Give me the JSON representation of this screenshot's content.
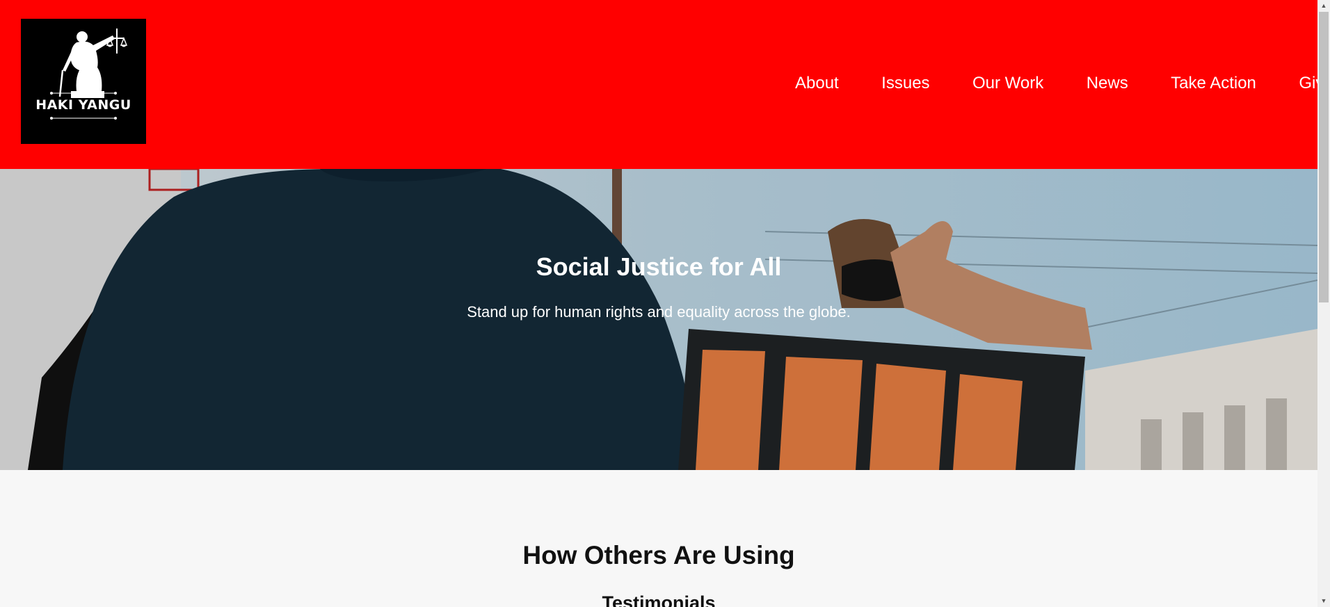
{
  "header": {
    "logo_text": "HAKI YANGU",
    "nav": [
      "About",
      "Issues",
      "Our Work",
      "News",
      "Take Action",
      "Give"
    ],
    "background_color": "#ff0000"
  },
  "hero": {
    "title": "Social Justice for All",
    "subtitle": "Stand up for human rights and equality across the globe."
  },
  "testimonials": {
    "title": "How Others Are Using",
    "subtitle": "Testimonials"
  },
  "icons": {
    "logo": "lady-justice-icon",
    "scroll_up": "scroll-up-arrow-icon",
    "scroll_down": "scroll-down-arrow-icon"
  }
}
